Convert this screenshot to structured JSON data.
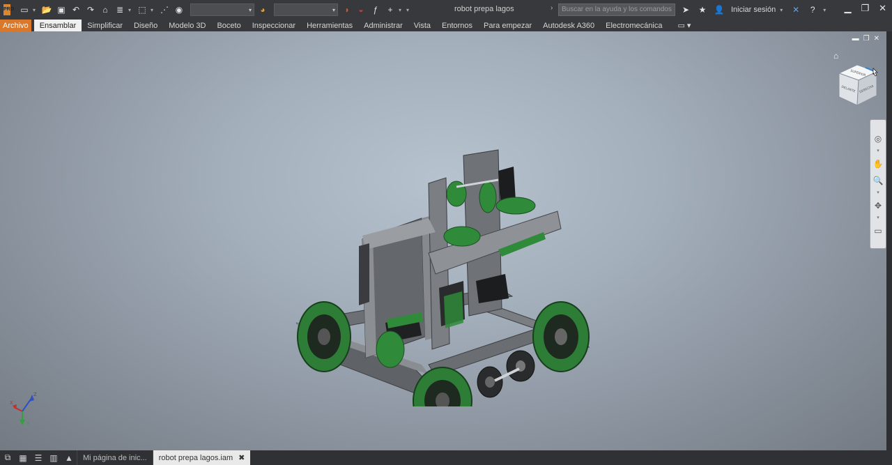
{
  "titlebar": {
    "app_logo_text": "PRO",
    "document_title": "robot prepa lagos",
    "search_placeholder": "Buscar en la ayuda y los comandos",
    "sign_in": "Iniciar sesión",
    "icons": [
      "new-icon",
      "open-icon",
      "save-icon",
      "undo-icon",
      "redo-icon",
      "home-icon",
      "update-icon",
      "select-icon",
      "measure-icon",
      "material-icon",
      "appearance-icon",
      "color-override-icon",
      "formula-icon",
      "add-icon"
    ]
  },
  "ribbon": {
    "tabs": [
      "Archivo",
      "Ensamblar",
      "Simplificar",
      "Diseño",
      "Modelo 3D",
      "Boceto",
      "Inspeccionar",
      "Herramientas",
      "Administrar",
      "Vista",
      "Entornos",
      "Para empezar",
      "Autodesk A360",
      "Electromecánica"
    ],
    "active_tab": "Ensamblar"
  },
  "viewcube": {
    "faces": [
      "SUPERIOR",
      "DELANTE",
      "DERECHA"
    ]
  },
  "triad": {
    "axes": [
      "X",
      "Y",
      "Z"
    ]
  },
  "colors": {
    "accent_orange": "#d9782a",
    "viewport_center": "#b7c2cf",
    "part_green": "#2f8a3a",
    "frame_gray": "#6b6e72"
  },
  "document_tabs": [
    {
      "label": "Mi página de inic...",
      "active": false,
      "closable": false
    },
    {
      "label": "robot prepa lagos.iam",
      "active": true,
      "closable": true
    }
  ]
}
